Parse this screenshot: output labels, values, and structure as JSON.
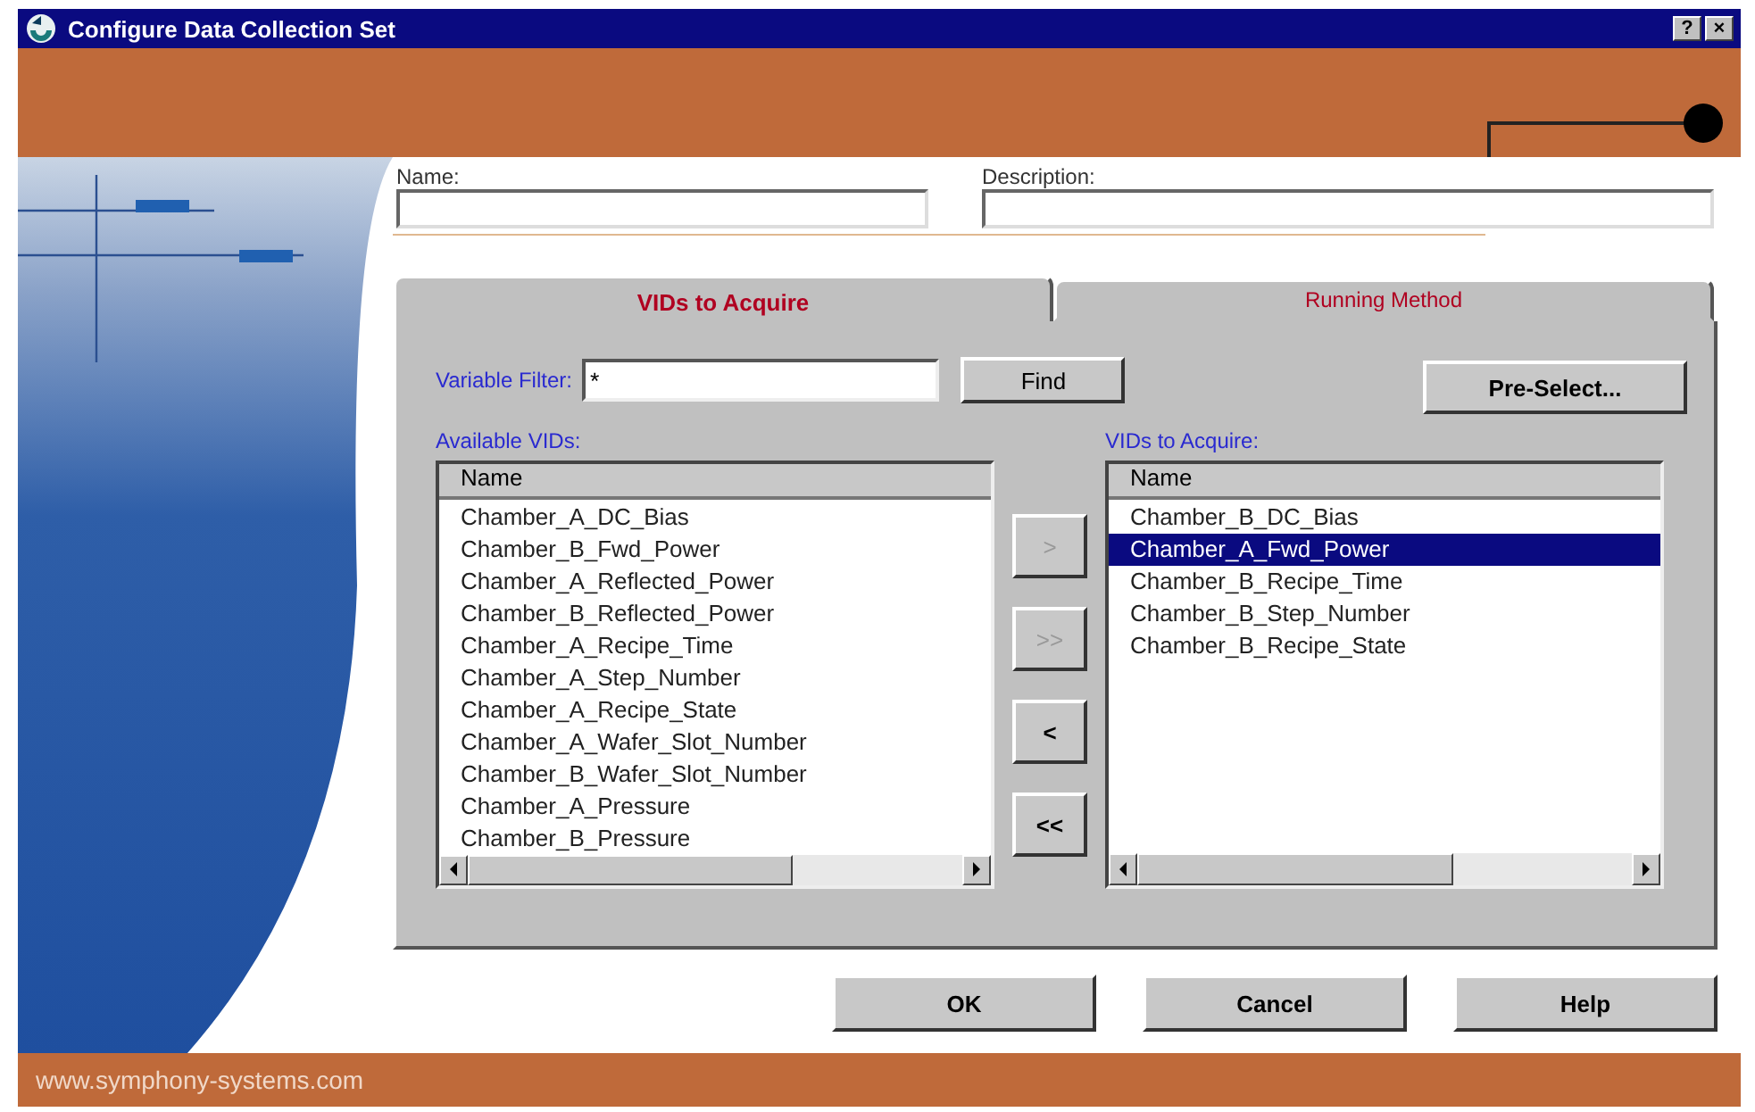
{
  "window": {
    "title": "Configure Data Collection Set",
    "title_buttons": [
      "?",
      "×"
    ]
  },
  "fields": [
    {
      "label": "Name:"
    },
    {
      "label": "Description:"
    }
  ],
  "tabs": [
    {
      "label": "VIDs to Acquire",
      "selected": true
    },
    {
      "label": "Running Method",
      "selected": false
    }
  ],
  "filter": {
    "label": "Variable Filter:",
    "value": "*",
    "find_button": "Find"
  },
  "preselect_button": "Pre-Select...",
  "available": {
    "label": "Available VIDs:",
    "column": "Name",
    "items": [
      {
        "text": "Chamber_A_DC_Bias",
        "selected": false
      },
      {
        "text": "Chamber_B_Fwd_Power",
        "selected": false
      },
      {
        "text": "Chamber_A_Reflected_Power",
        "selected": false
      },
      {
        "text": "Chamber_B_Reflected_Power",
        "selected": false
      },
      {
        "text": "Chamber_A_Recipe_Time",
        "selected": false
      },
      {
        "text": "Chamber_A_Step_Number",
        "selected": false
      },
      {
        "text": "Chamber_A_Recipe_State",
        "selected": false
      },
      {
        "text": "Chamber_A_Wafer_Slot_Number",
        "selected": false
      },
      {
        "text": "Chamber_B_Wafer_Slot_Number",
        "selected": false
      },
      {
        "text": "Chamber_A_Pressure",
        "selected": false
      },
      {
        "text": "Chamber_B_Pressure",
        "selected": false
      }
    ]
  },
  "move_buttons": [
    {
      "label": ">",
      "disabled": true
    },
    {
      "label": ">>",
      "disabled": true
    },
    {
      "label": "<",
      "disabled": false
    },
    {
      "label": "<<",
      "disabled": false
    }
  ],
  "acquire": {
    "label": "VIDs to Acquire:",
    "column": "Name",
    "items": [
      {
        "text": "Chamber_B_DC_Bias",
        "selected": false
      },
      {
        "text": "Chamber_A_Fwd_Power",
        "selected": true
      },
      {
        "text": "Chamber_B_Recipe_Time",
        "selected": false
      },
      {
        "text": "Chamber_B_Step_Number",
        "selected": false
      },
      {
        "text": "Chamber_B_Recipe_State",
        "selected": false
      }
    ]
  },
  "buttons": [
    "OK",
    "Cancel",
    "Help"
  ],
  "footer": "www.symphony-systems.com"
}
